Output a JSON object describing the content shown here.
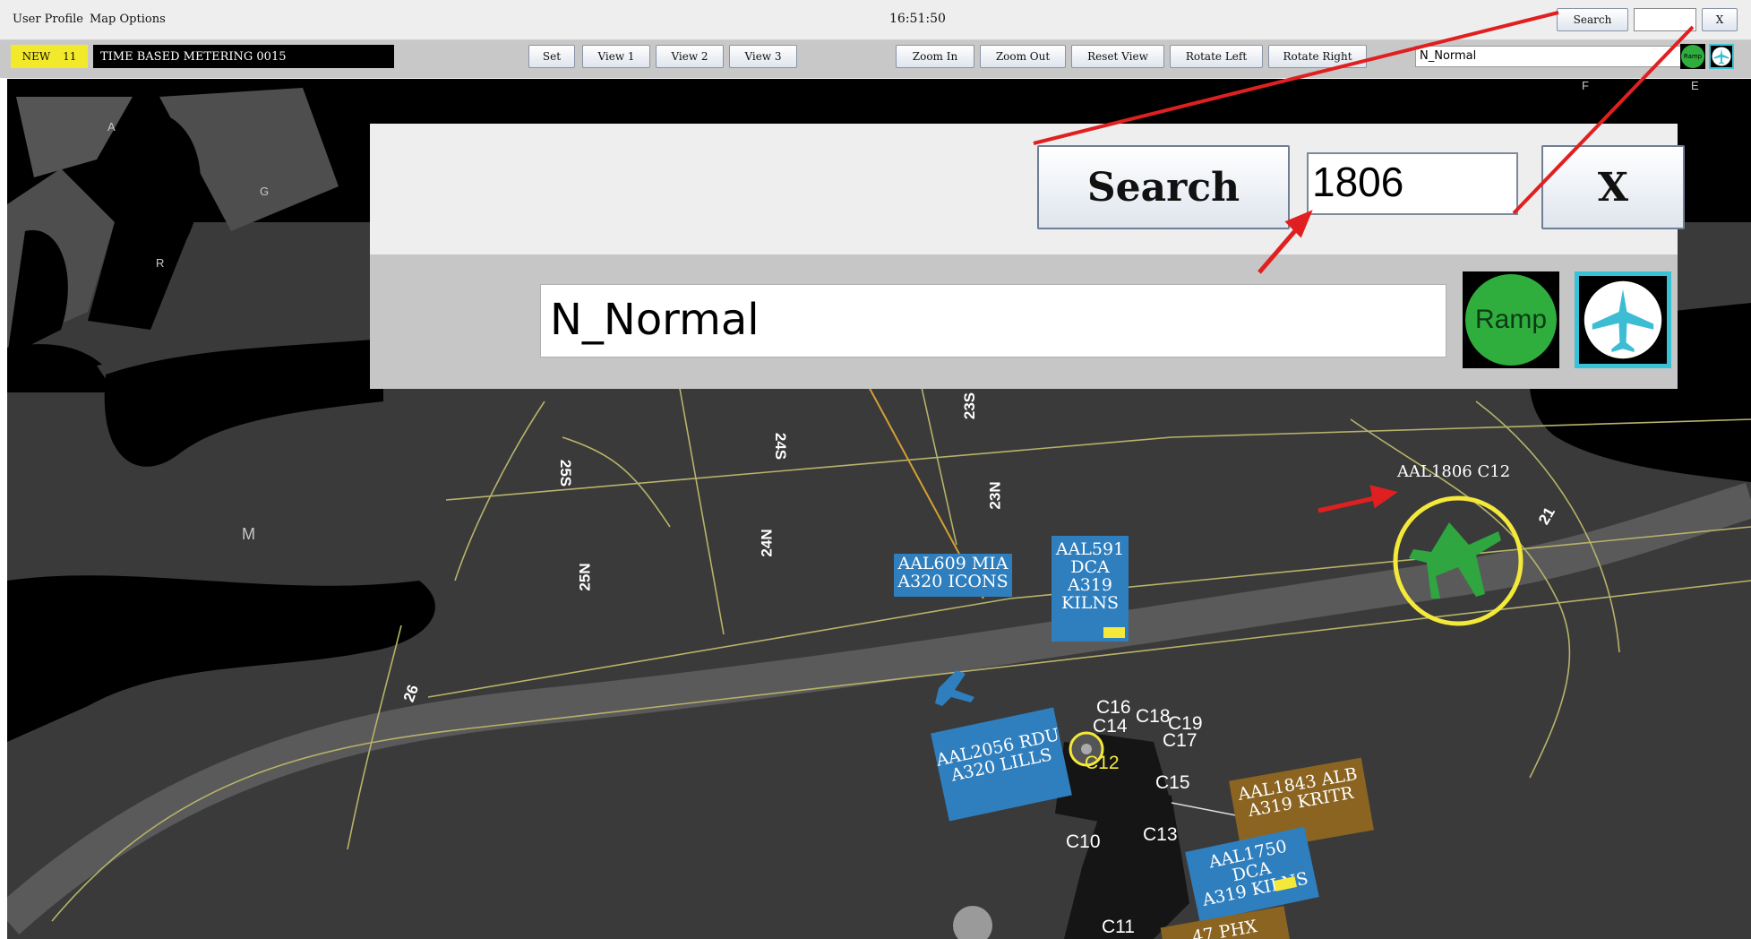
{
  "menubar": {
    "user_profile_label": "User Profile",
    "map_options_label": "Map Options",
    "clock": "16:51:50",
    "search_label": "Search",
    "search_value": "",
    "close_label": "X"
  },
  "toolbar": {
    "new_label": "NEW",
    "new_count": "11",
    "metering_label": "TIME BASED METERING 0015",
    "buttons": [
      "Set",
      "View 1",
      "View 2",
      "View 3",
      "Zoom In",
      "Zoom Out",
      "Reset View",
      "Rotate Left",
      "Rotate Right"
    ],
    "profile_value": "N_Normal",
    "ramp_label": "Ramp"
  },
  "zoom_panel": {
    "search_label": "Search",
    "search_value": "1806",
    "close_label": "X",
    "profile_value": "N_Normal",
    "ramp_label": "Ramp"
  },
  "map": {
    "zone_labels": [
      "A",
      "G",
      "R",
      "M",
      "F",
      "E"
    ],
    "taxiway_labels": [
      "25S",
      "24S",
      "23S",
      "23N",
      "24N",
      "25N",
      "26",
      "21"
    ],
    "gates": [
      "C16",
      "C14",
      "C18",
      "C19",
      "C17",
      "C12",
      "C15",
      "C10",
      "C13",
      "C11"
    ],
    "flights": [
      {
        "line1": "AAL609 MIA",
        "line2": "A320 ICONS"
      },
      {
        "line1": "AAL591",
        "line2": "DCA",
        "line3": "A319",
        "line4": "KILNS"
      },
      {
        "line1": "AAL2056 RDU",
        "line2": "A320 LILLS"
      },
      {
        "line1": "AAL1843 ALB",
        "line2": "A319 KRITR"
      },
      {
        "line1": "AAL1750 DCA",
        "line2": "A319 KILNS"
      },
      {
        "line1": "AAL1806 C12"
      },
      {
        "line1": "47 PHX"
      }
    ]
  },
  "colors": {
    "highlight_ring": "#f4e93a",
    "selected_flight": "#2fa640",
    "departure_tag": "#2f7fbf",
    "arrival_tag": "#8a6420",
    "annotation_arrow": "#e02020"
  }
}
